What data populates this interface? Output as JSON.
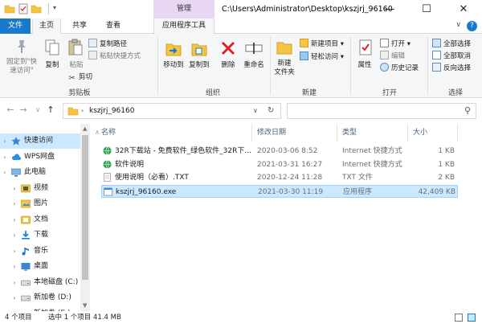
{
  "window": {
    "title": "C:\\Users\\Administrator\\Desktop\\kszjrj_96160",
    "context_group": "管理",
    "minimize": "—",
    "maximize": "☐",
    "close": "✕"
  },
  "tabs": {
    "file": "文件",
    "home": "主页",
    "share": "共享",
    "view": "查看",
    "app_tools": "应用程序工具"
  },
  "ribbon": {
    "clipboard": {
      "pin": "固定到\"快速访问\"",
      "copy": "复制",
      "paste": "粘贴",
      "copy_path": "复制路径",
      "paste_shortcut": "粘贴快捷方式",
      "cut": "剪切",
      "label": "剪贴板"
    },
    "organize": {
      "move_to": "移动到",
      "copy_to": "复制到",
      "delete": "删除",
      "rename": "重命名",
      "label": "组织"
    },
    "new": {
      "new_folder": "新建\n文件夹",
      "new_item": "新建项目",
      "easy_access": "轻松访问",
      "label": "新建"
    },
    "open": {
      "properties": "属性",
      "open": "打开",
      "edit": "编辑",
      "history": "历史记录",
      "label": "打开"
    },
    "select": {
      "select_all": "全部选择",
      "select_none": "全部取消",
      "invert": "反向选择",
      "label": "选择"
    }
  },
  "address": {
    "path": "kszjrj_96160",
    "back": "←",
    "forward": "→",
    "up": "↑",
    "refresh": "↻",
    "search_icon": "⚲"
  },
  "nav": [
    {
      "label": "快速访问",
      "icon": "star-icon",
      "level": 0,
      "selected": true
    },
    {
      "label": "WPS网盘",
      "icon": "cloud-icon",
      "level": 0,
      "selected": false
    },
    {
      "label": "此电脑",
      "icon": "computer-icon",
      "level": 0,
      "selected": false
    },
    {
      "label": "视频",
      "icon": "video-icon",
      "level": 1,
      "selected": false
    },
    {
      "label": "图片",
      "icon": "picture-icon",
      "level": 1,
      "selected": false
    },
    {
      "label": "文档",
      "icon": "document-icon",
      "level": 1,
      "selected": false
    },
    {
      "label": "下载",
      "icon": "download-icon",
      "level": 1,
      "selected": false
    },
    {
      "label": "音乐",
      "icon": "music-icon",
      "level": 1,
      "selected": false
    },
    {
      "label": "桌面",
      "icon": "desktop-icon",
      "level": 1,
      "selected": false
    },
    {
      "label": "本地磁盘 (C:)",
      "icon": "drive-icon",
      "level": 1,
      "selected": false
    },
    {
      "label": "新加卷 (D:)",
      "icon": "drive-icon",
      "level": 1,
      "selected": false
    },
    {
      "label": "新加卷 (E:)",
      "icon": "drive-icon",
      "level": 1,
      "selected": false
    }
  ],
  "columns": {
    "name": "名称",
    "modified": "修改日期",
    "type": "类型",
    "size": "大小"
  },
  "files": [
    {
      "name": "32R下载站 - 免费软件_绿色软件_32R下...",
      "modified": "2020-03-06 8:52",
      "type": "Internet 快捷方式",
      "size": "1 KB",
      "icon": "internet-shortcut-icon",
      "selected": false
    },
    {
      "name": "软件说明",
      "modified": "2021-03-31 16:27",
      "type": "Internet 快捷方式",
      "size": "1 KB",
      "icon": "internet-shortcut-icon",
      "selected": false
    },
    {
      "name": "使用说明（必看）.TXT",
      "modified": "2020-12-24 11:28",
      "type": "TXT 文件",
      "size": "2 KB",
      "icon": "text-file-icon",
      "selected": false
    },
    {
      "name": "kszjrj_96160.exe",
      "modified": "2021-03-30 11:19",
      "type": "应用程序",
      "size": "42,409 KB",
      "icon": "application-icon",
      "selected": true
    }
  ],
  "status": {
    "item_count": "4 个项目",
    "selection": "选中 1 个项目  41.4 MB"
  },
  "colors": {
    "accent": "#1979ca",
    "context_tab": "#e8d6f2",
    "selection": "#cce8ff"
  }
}
